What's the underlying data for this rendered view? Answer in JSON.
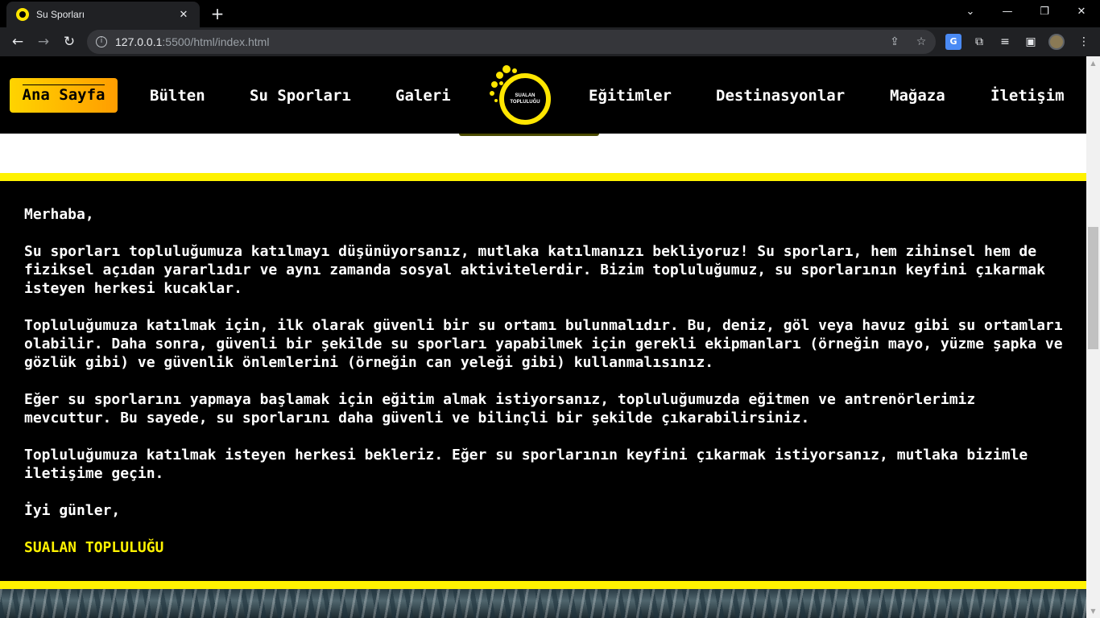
{
  "browser": {
    "tab_title": "Su Sporları",
    "tab_close": "✕",
    "new_tab": "+",
    "url_host": "127.0.0.1",
    "url_path": ":5500/html/index.html"
  },
  "site_nav": {
    "home_label": "Ana Sayfa",
    "items": [
      "Bülten",
      "Su Sporları",
      "Galeri",
      "Eğitimler",
      "Destinasyonlar",
      "Mağaza",
      "İletişim"
    ],
    "logo_text_line1": "SUALAN",
    "logo_text_line2": "TOPLULUĞU"
  },
  "letter": {
    "greeting": "Merhaba,",
    "paragraphs": [
      "Su sporları topluluğumuza katılmayı düşünüyorsanız, mutlaka katılmanızı bekliyoruz! Su sporları, hem zihinsel hem de fiziksel açıdan yararlıdır ve aynı zamanda sosyal aktivitelerdir. Bizim topluluğumuz, su sporlarının keyfini çıkarmak isteyen herkesi kucaklar.",
      "Topluluğumuza katılmak için, ilk olarak güvenli bir su ortamı bulunmalıdır. Bu, deniz, göl veya havuz gibi su ortamları olabilir. Daha sonra, güvenli bir şekilde su sporları yapabilmek için gerekli ekipmanları (örneğin mayo, yüzme şapka ve gözlük gibi) ve güvenlik önlemlerini (örneğin can yeleği gibi) kullanmalısınız.",
      "Eğer su sporlarını yapmaya başlamak için eğitim almak istiyorsanız, topluluğumuzda eğitmen ve antrenörlerimiz mevcuttur. Bu sayede, su sporlarını daha güvenli ve bilinçli bir şekilde çıkarabilirsiniz.",
      "Topluluğumuza katılmak isteyen herkesi bekleriz. Eğer su sporlarının keyfini çıkarmak istiyorsanız, mutlaka bizimle iletişime geçin."
    ],
    "closing": "İyi günler,",
    "signature": "SUALAN TOPLULUĞU"
  },
  "colors": {
    "accent_yellow": "#fff200",
    "page_background": "#000000",
    "home_button_gradient_start": "#ffd400",
    "home_button_gradient_end": "#ff9d00"
  }
}
